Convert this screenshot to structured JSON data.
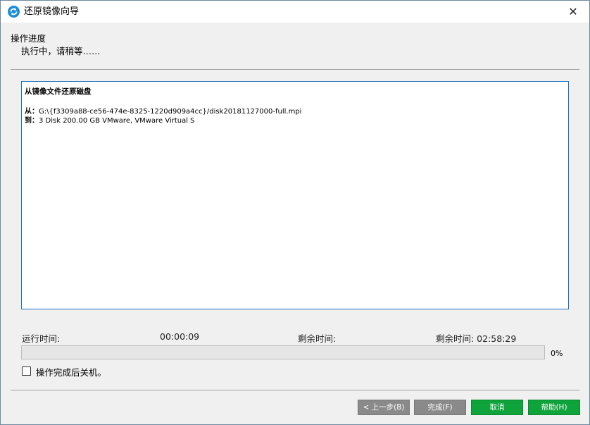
{
  "window": {
    "title": "还原镜像向导",
    "close_glyph": "✕"
  },
  "header": {
    "title": "操作进度",
    "subtitle": "执行中，请稍等……"
  },
  "info": {
    "heading": "从镜像文件还原磁盘",
    "from_label": "从：",
    "from_value": "G:\\{f3309a88-ce56-474e-8325-1220d909a4cc}/disk20181127000-full.mpi",
    "to_label": "到：",
    "to_value": "3 Disk 200.00 GB VMware, VMware Virtual S"
  },
  "status": {
    "elapsed_label": "运行时间:",
    "elapsed_value": "00:00:09",
    "remaining_label": "剩余时间:",
    "remaining_value_text": "剩余时间: 02:58:29",
    "progress_percent": 0,
    "progress_text": "0%"
  },
  "options": {
    "shutdown_label": "操作完成后关机。",
    "shutdown_checked": false
  },
  "buttons": {
    "back": "< 上一步(B)",
    "finish": "完成(F)",
    "cancel": "取消",
    "help": "帮助(H)"
  },
  "colors": {
    "accent_border": "#1e6fbf",
    "button_gray": "#8a8a8a",
    "button_green": "#0ea33b",
    "app_icon": "#1a8fd8"
  }
}
